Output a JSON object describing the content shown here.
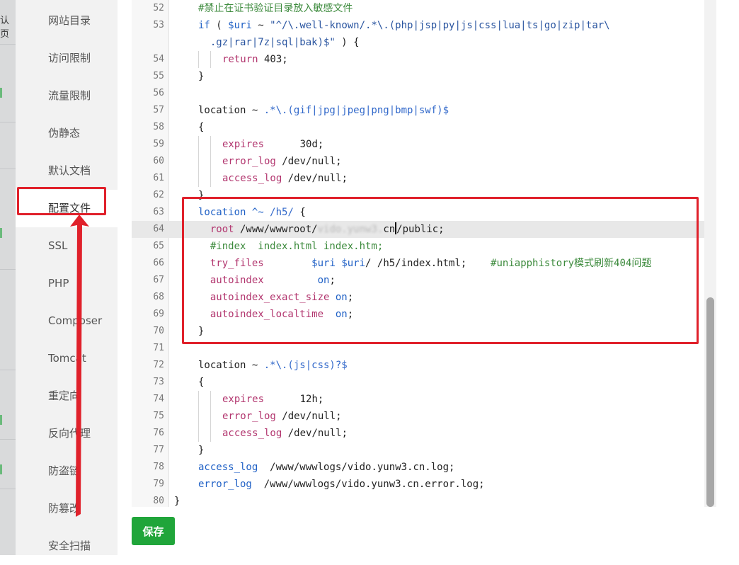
{
  "background_page": {
    "tab_fragment": "认页"
  },
  "sidebar": {
    "items": [
      {
        "label": "网站目录",
        "active": false
      },
      {
        "label": "访问限制",
        "active": false
      },
      {
        "label": "流量限制",
        "active": false
      },
      {
        "label": "伪静态",
        "active": false
      },
      {
        "label": "默认文档",
        "active": false
      },
      {
        "label": "配置文件",
        "active": true
      },
      {
        "label": "SSL",
        "active": false
      },
      {
        "label": "PHP",
        "active": false
      },
      {
        "label": "Composer",
        "active": false
      },
      {
        "label": "Tomcat",
        "active": false
      },
      {
        "label": "重定向",
        "active": false
      },
      {
        "label": "反向代理",
        "active": false
      },
      {
        "label": "防盗链",
        "active": false
      },
      {
        "label": "防篡改",
        "active": false
      },
      {
        "label": "安全扫描",
        "active": false
      }
    ]
  },
  "editor": {
    "first_line": 52,
    "highlighted_line": 64,
    "lines": [
      {
        "n": "52",
        "indent": 0,
        "tokens": [
          [
            "cmt",
            "#禁止在证书验证目录放入敏感文件"
          ]
        ]
      },
      {
        "n": "53",
        "indent": 0,
        "tokens": [
          [
            "kw",
            "if"
          ],
          [
            "plain",
            " ( "
          ],
          [
            "var",
            "$uri"
          ],
          [
            "plain",
            " ~ "
          ],
          [
            "str",
            "\"^/\\.well-known/.*\\.(php|jsp|py|js|css|lua|ts|go|zip|tar\\"
          ]
        ]
      },
      {
        "n": "",
        "indent": 0,
        "tokens": [
          [
            "str",
            "  .gz|rar|7z|sql|bak)$\""
          ],
          [
            "plain",
            " ) {"
          ]
        ]
      },
      {
        "n": "54",
        "indent": 1,
        "tokens": [
          [
            "dir",
            "return"
          ],
          [
            "plain",
            " 403;"
          ]
        ]
      },
      {
        "n": "55",
        "indent": 0,
        "tokens": [
          [
            "plain",
            "}"
          ]
        ]
      },
      {
        "n": "56",
        "indent": 0,
        "tokens": []
      },
      {
        "n": "57",
        "indent": 0,
        "tokens": [
          [
            "plain",
            "location ~ "
          ],
          [
            "rx",
            ".*\\.(gif|jpg|jpeg|png|bmp|swf)$"
          ]
        ]
      },
      {
        "n": "58",
        "indent": 0,
        "tokens": [
          [
            "plain",
            "{"
          ]
        ]
      },
      {
        "n": "59",
        "indent": 1,
        "tokens": [
          [
            "dir",
            "expires"
          ],
          [
            "plain",
            "      30d;"
          ]
        ]
      },
      {
        "n": "60",
        "indent": 1,
        "tokens": [
          [
            "dir",
            "error_log"
          ],
          [
            "plain",
            " /dev/null;"
          ]
        ]
      },
      {
        "n": "61",
        "indent": 1,
        "tokens": [
          [
            "dir",
            "access_log"
          ],
          [
            "plain",
            " /dev/null;"
          ]
        ]
      },
      {
        "n": "62",
        "indent": 0,
        "tokens": [
          [
            "plain",
            "}"
          ]
        ]
      },
      {
        "n": "63",
        "indent": 0,
        "tokens": [
          [
            "kw",
            "location"
          ],
          [
            "plain",
            " "
          ],
          [
            "kw",
            "^~"
          ],
          [
            "plain",
            " "
          ],
          [
            "rx",
            "/h5/"
          ],
          [
            "plain",
            " {"
          ]
        ]
      },
      {
        "n": "64",
        "indent": 0,
        "tokens": [
          [
            "dir",
            "  root"
          ],
          [
            "plain",
            " /www/wwwroot/"
          ],
          [
            "blur",
            "vido.yunw3."
          ],
          [
            "plain",
            "cn"
          ],
          [
            "cursor",
            ""
          ],
          [
            "plain",
            "/public;"
          ]
        ]
      },
      {
        "n": "65",
        "indent": 0,
        "tokens": [
          [
            "cmt",
            "  #index  index.html index.htm;"
          ]
        ]
      },
      {
        "n": "66",
        "indent": 0,
        "tokens": [
          [
            "dir",
            "  try_files"
          ],
          [
            "plain",
            "        "
          ],
          [
            "var",
            "$uri"
          ],
          [
            "plain",
            " "
          ],
          [
            "var",
            "$uri"
          ],
          [
            "plain",
            "/ /h5/index.html;    "
          ],
          [
            "cmt",
            "#uniapphistory模式刷新404问题"
          ]
        ]
      },
      {
        "n": "67",
        "indent": 0,
        "tokens": [
          [
            "dir",
            "  autoindex"
          ],
          [
            "plain",
            "         "
          ],
          [
            "on",
            "on"
          ],
          [
            "plain",
            ";"
          ]
        ]
      },
      {
        "n": "68",
        "indent": 0,
        "tokens": [
          [
            "dir",
            "  autoindex_exact_size"
          ],
          [
            "plain",
            " "
          ],
          [
            "on",
            "on"
          ],
          [
            "plain",
            ";"
          ]
        ]
      },
      {
        "n": "69",
        "indent": 0,
        "tokens": [
          [
            "dir",
            "  autoindex_localtime"
          ],
          [
            "plain",
            "  "
          ],
          [
            "on",
            "on"
          ],
          [
            "plain",
            ";"
          ]
        ]
      },
      {
        "n": "70",
        "indent": 0,
        "tokens": [
          [
            "plain",
            "}"
          ]
        ]
      },
      {
        "n": "71",
        "indent": 0,
        "tokens": []
      },
      {
        "n": "72",
        "indent": 0,
        "tokens": [
          [
            "plain",
            "location ~ "
          ],
          [
            "rx",
            ".*\\.(js|css)?$"
          ]
        ]
      },
      {
        "n": "73",
        "indent": 0,
        "tokens": [
          [
            "plain",
            "{"
          ]
        ]
      },
      {
        "n": "74",
        "indent": 1,
        "tokens": [
          [
            "dir",
            "expires"
          ],
          [
            "plain",
            "      12h;"
          ]
        ]
      },
      {
        "n": "75",
        "indent": 1,
        "tokens": [
          [
            "dir",
            "error_log"
          ],
          [
            "plain",
            " /dev/null;"
          ]
        ]
      },
      {
        "n": "76",
        "indent": 1,
        "tokens": [
          [
            "dir",
            "access_log"
          ],
          [
            "plain",
            " /dev/null;"
          ]
        ]
      },
      {
        "n": "77",
        "indent": 0,
        "tokens": [
          [
            "plain",
            "}"
          ]
        ]
      },
      {
        "n": "78",
        "indent": 0,
        "tokens": [
          [
            "kw",
            "access_log"
          ],
          [
            "plain",
            "  /www/wwwlogs/vido.yunw3.cn.log;"
          ]
        ]
      },
      {
        "n": "79",
        "indent": 0,
        "tokens": [
          [
            "kw",
            "error_log"
          ],
          [
            "plain",
            "  /www/wwwlogs/vido.yunw3.cn.error.log;"
          ]
        ]
      },
      {
        "n": "80",
        "indent": -1,
        "tokens": [
          [
            "plain",
            "}"
          ]
        ]
      }
    ]
  },
  "save_button": {
    "label": "保存"
  },
  "annotation": {
    "color": "#e0212b"
  },
  "colors": {
    "accent_green": "#20a53a",
    "comment": "#3c8a3c",
    "keyword": "#2061c6",
    "directive": "#b2356e",
    "sidebar_bg": "#f2f2f2"
  }
}
